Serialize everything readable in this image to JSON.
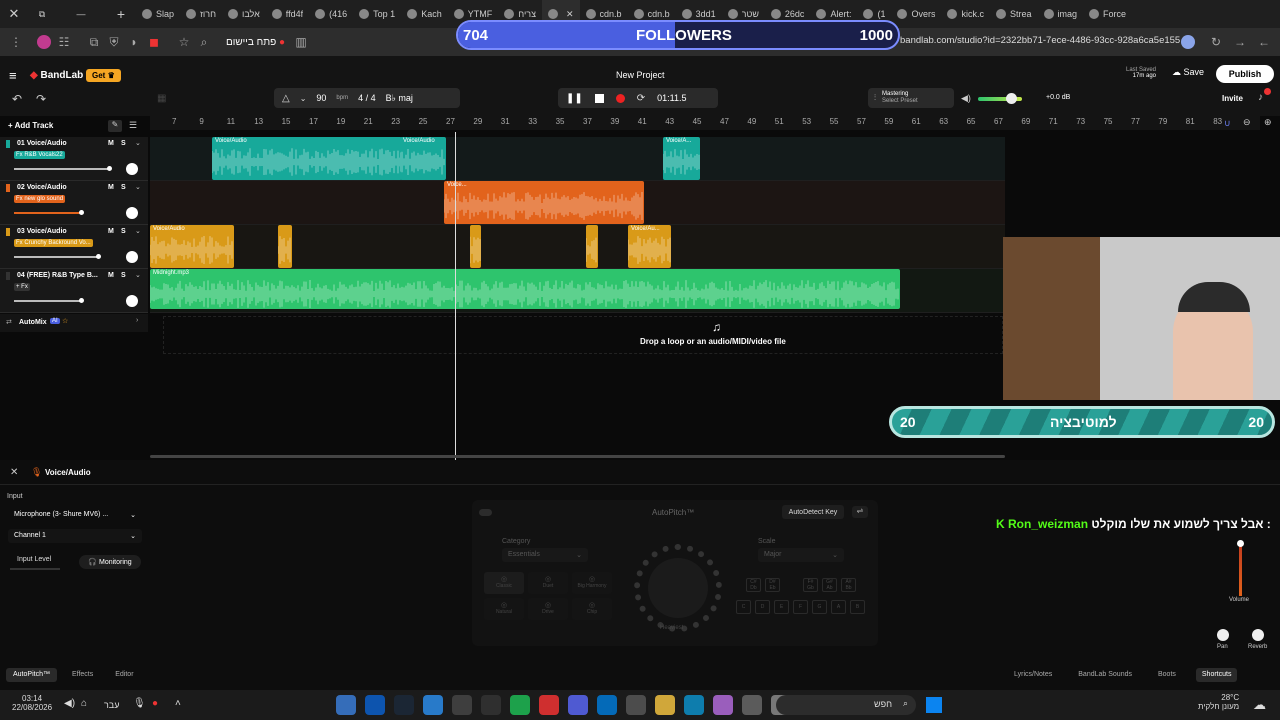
{
  "browser": {
    "tabs": [
      "Slap",
      "חרוז",
      "אלבו",
      "ffd4f",
      "(416",
      "Top 1",
      "Kach",
      "YTMF",
      "צריח",
      "",
      "cdn.b",
      "cdn.b",
      "3dd1",
      "שטר",
      "26dc",
      "Alert:",
      "(1",
      "Overs",
      "kick.c",
      "Strea",
      "imag",
      "Force"
    ],
    "url": "bandlab.com/studio?id=2322bb71-7ece-4486-93cc-928a6ca5e155",
    "open_in_app": "פתח ביישום"
  },
  "followers": {
    "current": "704",
    "label": "FOLLOWERS",
    "goal": "1000",
    "progress": 0.704
  },
  "app": {
    "logo": "BandLab",
    "get_label": "Get",
    "project_title": "New Project",
    "last_saved_label": "Last Saved",
    "last_saved_value": "17m ago",
    "save_label": "Save",
    "publish_label": "Publish",
    "invite_label": "Invite",
    "tempo": "90",
    "bpm_label": "bpm",
    "time_signature": "4 / 4",
    "key": "B♭ maj",
    "time": "01:11.5",
    "mastering_label": "Mastering",
    "mastering_preset": "Select Preset",
    "volume_db": "+0.0 dB"
  },
  "ruler": [
    "7",
    "9",
    "11",
    "13",
    "15",
    "17",
    "19",
    "21",
    "23",
    "25",
    "27",
    "29",
    "31",
    "33",
    "35",
    "37",
    "39",
    "41",
    "43",
    "45",
    "47",
    "49",
    "51",
    "53",
    "55",
    "57",
    "59",
    "61",
    "63",
    "65",
    "67",
    "69",
    "71",
    "73",
    "75",
    "77",
    "79",
    "81",
    "83"
  ],
  "tracks": [
    {
      "name": "01 Voice/Audio",
      "fx": "Fx R&B Vocals22",
      "fx_color": "#17a99a"
    },
    {
      "name": "02 Voice/Audio",
      "fx": "Fx new glo sound",
      "fx_color": "#e2631c"
    },
    {
      "name": "03 Voice/Audio",
      "fx": "Fx Crunchy Backround Vo...",
      "fx_color": "#d99a18"
    },
    {
      "name": "04 (FREE) R&B Type B...",
      "fx": "+ Fx",
      "fx_color": "#333333"
    }
  ],
  "clip_labels": {
    "t1a": "Voice/Audio",
    "t1b": "Voice/Audio",
    "t1c": "Voice/A...",
    "t2": "Voice...",
    "t3a": "Voice/Audio",
    "t3b": "Voice/Au...",
    "t4": "Midnight.mp3"
  },
  "automix_label": "AutoMix",
  "automix_badge": "AI",
  "add_track": "Add Track",
  "drop_hint": "Drop a loop or an audio/MIDI/video file",
  "motivation": {
    "left": "20",
    "label": "למוטיבציה",
    "right": "20"
  },
  "panel": {
    "track_title": "Voice/Audio",
    "input_label": "Input",
    "input_device": "Microphone (3- Shure MV6) ...",
    "channel": "Channel 1",
    "input_level_label": "Input Level",
    "monitoring_label": "Monitoring",
    "autopitch_title": "AutoPitch™",
    "autodetect_label": "AutoDetect Key",
    "category_label": "Category",
    "category_value": "Essentials",
    "scale_label": "Scale",
    "scale_value": "Major",
    "effect_names": [
      "Classic",
      "Duet",
      "Big Harmony",
      "Natural",
      "Drive",
      "Chip"
    ],
    "knob_label": "Heaviest",
    "notes": [
      "C#\nDb",
      "D#\nEb",
      "F#\nGb",
      "G#\nAb",
      "A#\nBb"
    ],
    "notes_white": [
      "C",
      "D",
      "E",
      "F",
      "G",
      "A",
      "B"
    ],
    "volume_label": "Volume",
    "pan_label": "Pan",
    "reverb_label": "Reverb"
  },
  "chat": {
    "user": "Ron_weizman",
    "message": "אבל צריך לשמוע את שלו מוקלט :"
  },
  "bottom_tabs": [
    "AutoPitch™",
    "Effects",
    "Editor"
  ],
  "bottom_right": [
    "Lyrics/Notes",
    "BandLab Sounds",
    "Boots",
    "Shortcuts"
  ],
  "taskbar": {
    "time": "03:14",
    "date": "22/08/2026",
    "lang": "עבר",
    "search": "חפש",
    "weather": "28°C",
    "weather_desc": "מעונן חלקית"
  },
  "colors": {
    "teal": "#17a99a",
    "orange": "#e2631c",
    "gold": "#d99a18",
    "green": "#2ec46d",
    "accent": "#4a5fe0"
  }
}
